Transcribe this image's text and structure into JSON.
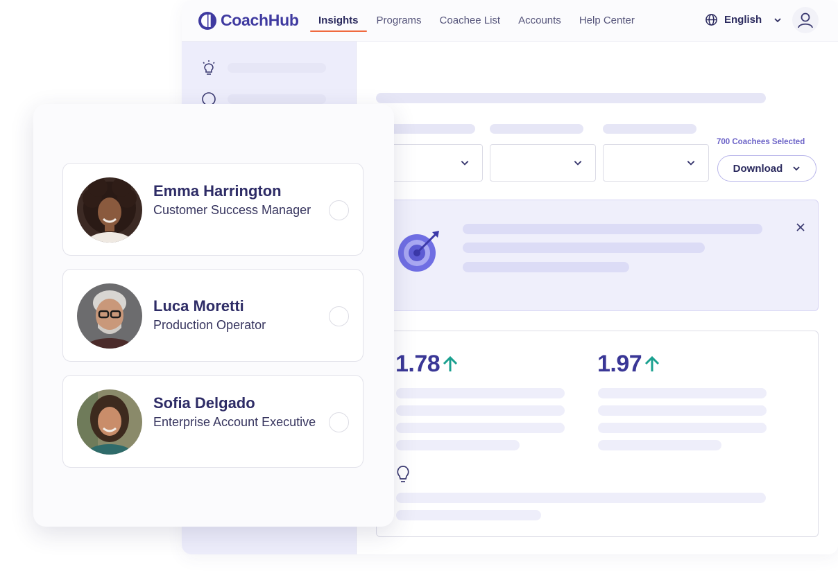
{
  "header": {
    "brand": "CoachHub",
    "nav": [
      {
        "label": "Insights",
        "active": true
      },
      {
        "label": "Programs"
      },
      {
        "label": "Coachee List"
      },
      {
        "label": "Accounts"
      },
      {
        "label": "Help Center"
      }
    ],
    "language": "English"
  },
  "filters": {
    "selected_count": "700 Coachees Selected",
    "download_label": "Download"
  },
  "stats": [
    {
      "value": "1.78",
      "trend": "up"
    },
    {
      "value": "1.97",
      "trend": "up"
    }
  ],
  "coachees": [
    {
      "name": "Emma Harrington",
      "role": "Customer Success Manager"
    },
    {
      "name": "Luca Moretti",
      "role": "Production Operator"
    },
    {
      "name": "Sofia Delgado",
      "role": "Enterprise Account Executive"
    }
  ],
  "icons": {
    "brand": "coachhub-logo-icon",
    "language": "globe-icon",
    "profile": "user-icon",
    "sidebar": [
      "lightbulb-icon",
      "search-icon"
    ],
    "banner": "target-icon",
    "trend": "arrow-up-icon",
    "tip": "lightbulb-icon"
  },
  "colors": {
    "brand": "#3f3aa0",
    "accent_underline": "#f06a3f",
    "trend_up": "#1aa08f",
    "sidebar_bg": "#ededfb",
    "banner_bg": "#efeffb"
  }
}
